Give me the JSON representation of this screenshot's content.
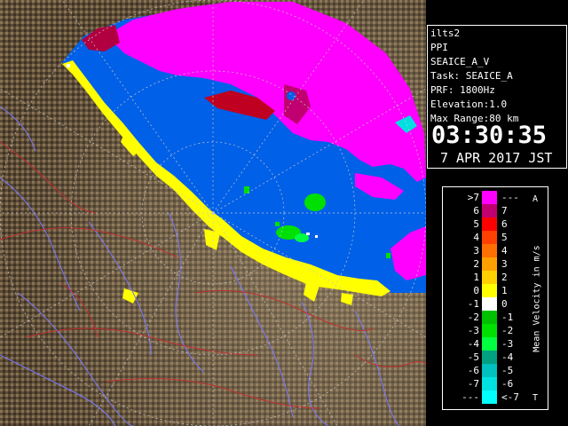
{
  "info": {
    "site": "ilts2",
    "mode": "PPI",
    "product": "SEAICE_A_V",
    "task": "Task: SEAICE_A",
    "prf": "PRF: 1800Hz",
    "elevation": "Elevation:1.0",
    "max_range": "Max Range:80 km",
    "time": "03:30:35",
    "date": "7 APR 2017 JST"
  },
  "legend": {
    "title": "Mean Velocity in m/s",
    "end_top": "A",
    "end_bottom": "T",
    "rows": [
      {
        "left": ">7",
        "right": "---",
        "color": "#ff00ff"
      },
      {
        "left": "6",
        "right": "7",
        "color": "#c00070"
      },
      {
        "left": "5",
        "right": "6",
        "color": "#ff0000"
      },
      {
        "left": "4",
        "right": "5",
        "color": "#ff4000"
      },
      {
        "left": "3",
        "right": "4",
        "color": "#ff7000"
      },
      {
        "left": "2",
        "right": "3",
        "color": "#ffa000"
      },
      {
        "left": "1",
        "right": "2",
        "color": "#ffd000"
      },
      {
        "left": "0",
        "right": "1",
        "color": "#ffff00"
      },
      {
        "left": "-1",
        "right": "0",
        "color": "#ffffff"
      },
      {
        "left": "-2",
        "right": "-1",
        "color": "#00c000"
      },
      {
        "left": "-3",
        "right": "-2",
        "color": "#00e000"
      },
      {
        "left": "-4",
        "right": "-3",
        "color": "#00ff40"
      },
      {
        "left": "-5",
        "right": "-4",
        "color": "#00a080"
      },
      {
        "left": "-6",
        "right": "-5",
        "color": "#00c0c0"
      },
      {
        "left": "-7",
        "right": "-6",
        "color": "#00e0e0"
      },
      {
        "left": "---",
        "right": "<-7",
        "color": "#00ffff"
      }
    ]
  },
  "colors": {
    "sea": "#0060e8",
    "ice_far": "#ff00ff",
    "coast": "#ffff00",
    "land": "#5a4b36",
    "rivers": "#7a7aff",
    "roads": "#c03030"
  }
}
